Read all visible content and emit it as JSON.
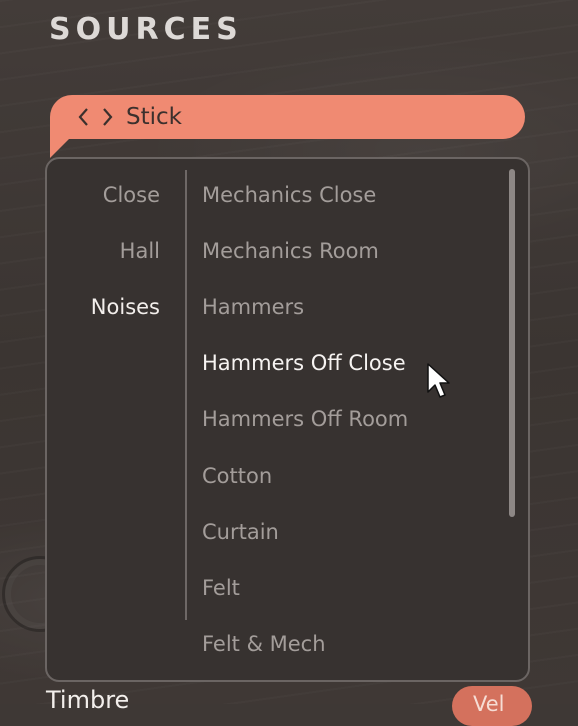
{
  "header": {
    "title": "SOURCES"
  },
  "selector": {
    "current": "Stick",
    "prev_icon": "chevron-left-icon",
    "next_icon": "chevron-right-icon",
    "accent_color": "#f08a72"
  },
  "dropdown": {
    "categories": [
      {
        "label": "Close",
        "active": false
      },
      {
        "label": "Hall",
        "active": false
      },
      {
        "label": "Noises",
        "active": true
      }
    ],
    "sources": [
      {
        "label": "Mechanics Close",
        "hovered": false
      },
      {
        "label": "Mechanics Room",
        "hovered": false
      },
      {
        "label": "Hammers",
        "hovered": false
      },
      {
        "label": "Hammers Off Close",
        "hovered": true
      },
      {
        "label": "Hammers Off Room",
        "hovered": false
      },
      {
        "label": "Cotton",
        "hovered": false
      },
      {
        "label": "Curtain",
        "hovered": false
      },
      {
        "label": "Felt",
        "hovered": false
      },
      {
        "label": "Felt & Mech",
        "hovered": false
      }
    ]
  },
  "footer": {
    "timbre_label": "Timbre",
    "vel_label": "Vel"
  }
}
